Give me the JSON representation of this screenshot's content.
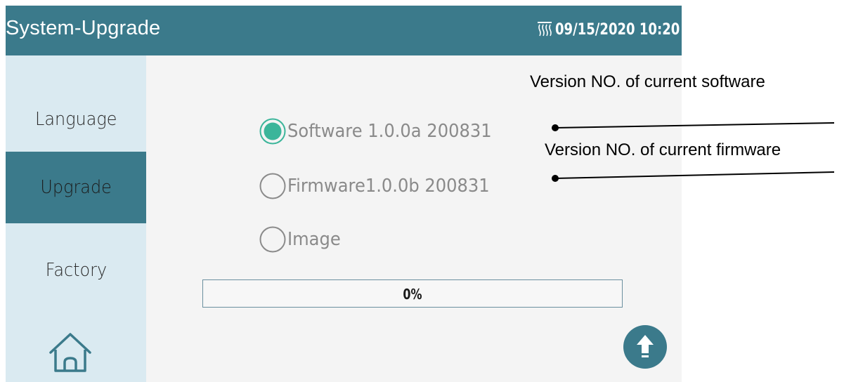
{
  "header": {
    "title": "System-Upgrade",
    "datetime": "09/15/2020 10:20",
    "status_icon": "heater-icon"
  },
  "sidebar": {
    "items": [
      {
        "label": "Language",
        "selected": false
      },
      {
        "label": "Upgrade",
        "selected": true
      },
      {
        "label": "Factory",
        "selected": false
      }
    ],
    "home_icon": "home-icon"
  },
  "options": [
    {
      "label": "Software 1.0.0a 200831",
      "selected": true
    },
    {
      "label": "Firmware1.0.0b 200831",
      "selected": false
    },
    {
      "label": "Image",
      "selected": false
    }
  ],
  "progress": {
    "text": "0%",
    "value": 0
  },
  "upload_button": {
    "icon": "arrow-up-icon"
  },
  "annotations": {
    "software": "Version NO. of current software",
    "firmware": "Version NO. of current firmware"
  },
  "colors": {
    "accent": "#3b7a8b",
    "sidebar_bg": "#daeaf1",
    "radio_selected": "#3bb59a"
  }
}
